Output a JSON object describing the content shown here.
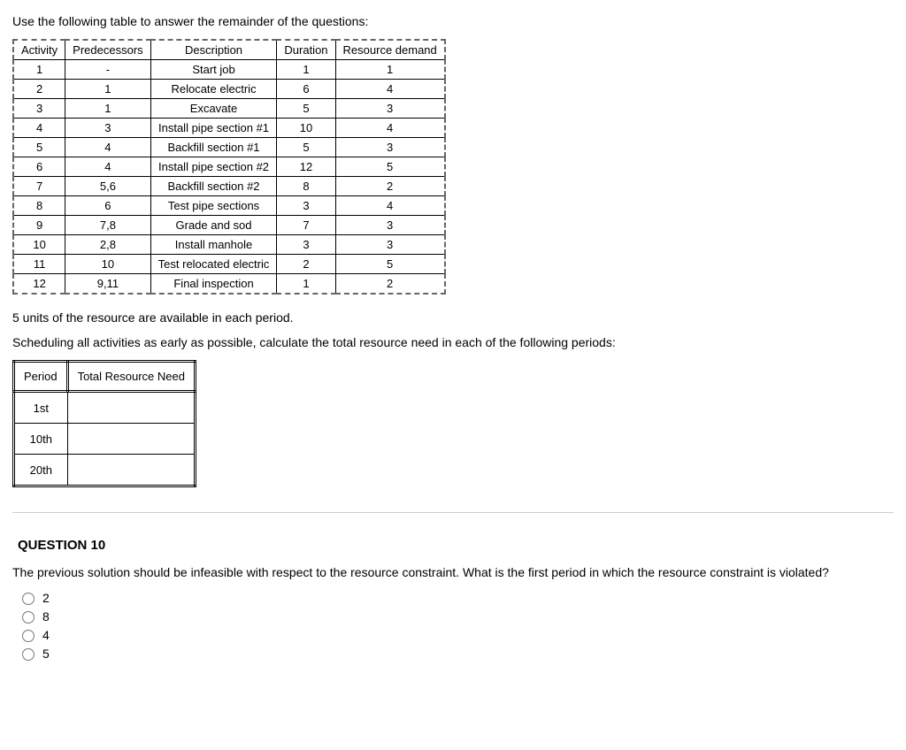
{
  "intro": "Use the following table to answer the remainder of the questions:",
  "table1": {
    "headers": [
      "Activity",
      "Predecessors",
      "Description",
      "Duration",
      "Resource demand"
    ],
    "rows": [
      {
        "activity": "1",
        "pred": "-",
        "desc": "Start job",
        "dur": "1",
        "res": "1"
      },
      {
        "activity": "2",
        "pred": "1",
        "desc": "Relocate electric",
        "dur": "6",
        "res": "4"
      },
      {
        "activity": "3",
        "pred": "1",
        "desc": "Excavate",
        "dur": "5",
        "res": "3"
      },
      {
        "activity": "4",
        "pred": "3",
        "desc": "Install pipe section #1",
        "dur": "10",
        "res": "4"
      },
      {
        "activity": "5",
        "pred": "4",
        "desc": "Backfill section #1",
        "dur": "5",
        "res": "3"
      },
      {
        "activity": "6",
        "pred": "4",
        "desc": "Install pipe section #2",
        "dur": "12",
        "res": "5"
      },
      {
        "activity": "7",
        "pred": "5,6",
        "desc": "Backfill section #2",
        "dur": "8",
        "res": "2"
      },
      {
        "activity": "8",
        "pred": "6",
        "desc": "Test pipe sections",
        "dur": "3",
        "res": "4"
      },
      {
        "activity": "9",
        "pred": "7,8",
        "desc": "Grade and sod",
        "dur": "7",
        "res": "3"
      },
      {
        "activity": "10",
        "pred": "2,8",
        "desc": "Install manhole",
        "dur": "3",
        "res": "3"
      },
      {
        "activity": "11",
        "pred": "10",
        "desc": "Test relocated electric",
        "dur": "2",
        "res": "5"
      },
      {
        "activity": "12",
        "pred": "9,11",
        "desc": "Final inspection",
        "dur": "1",
        "res": "2"
      }
    ]
  },
  "resource_note": "5 units of the resource are available in each period.",
  "schedule_prompt": "Scheduling all activities as early as possible, calculate the total resource need in each of the following periods:",
  "table2": {
    "headers": [
      "Period",
      "Total Resource Need"
    ],
    "periods": [
      "1st",
      "10th",
      "20th"
    ]
  },
  "question": {
    "title": "QUESTION 10",
    "text": "The previous solution should be infeasible with respect to the resource constraint. What is the first period in which the resource constraint is violated?",
    "options": [
      "2",
      "8",
      "4",
      "5"
    ]
  }
}
